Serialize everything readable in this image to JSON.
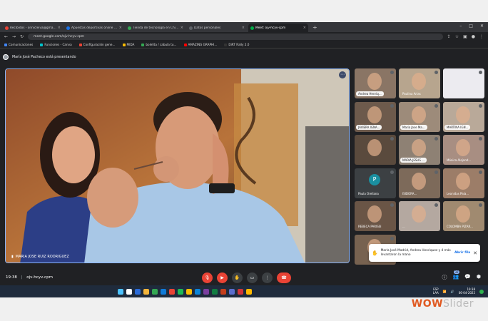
{
  "browser": {
    "tabs": [
      {
        "label": "Recibidos - onnicleiva@gmail.com",
        "color": "#ea4335"
      },
      {
        "label": "Apuestas deportivas online en Chile",
        "color": "#1a73e8"
      },
      {
        "label": "Tienda de tecnología en Chile |",
        "color": "#34a853"
      },
      {
        "label": "Datos personales",
        "color": "#5f6368"
      },
      {
        "label": "Meet: ojv-hcyv-cpm",
        "color": "#00ac47",
        "active": true
      }
    ],
    "new_tab": "+",
    "url": "meet.google.com/ojv-hcyv-cpm",
    "bookmarks": [
      {
        "label": "Comunicaciones",
        "color": "#4285f4"
      },
      {
        "label": "Funciones - Canva",
        "color": "#00c4cc"
      },
      {
        "label": "Configuración gene...",
        "color": "#ea4335"
      },
      {
        "label": "MIDA",
        "color": "#fbbc04"
      },
      {
        "label": "bolelita / cabula tu...",
        "color": "#34a853"
      },
      {
        "label": "AMAZING GRAPHI...",
        "color": "#ff0000"
      },
      {
        "label": "DiRT Rally 2.0",
        "color": "#333333"
      }
    ]
  },
  "meet": {
    "presenting_text": "María José Pacheco está presentando",
    "main_participant": "MARIA JOSE RUIZ RODRIGUEZ",
    "tiles": [
      {
        "name": "Andrea Henriq...",
        "bg": "#8a7565",
        "dark": false
      },
      {
        "name": "Paulina Arias",
        "bg": "#b7a58e",
        "dark": true
      },
      {
        "name": "",
        "bg": "#ecebf0",
        "dark": false
      },
      {
        "name": "JAVIERA IGNA...",
        "bg": "#6d5a4c",
        "dark": false
      },
      {
        "name": "María Jose Ma...",
        "bg": "#9d8b7a",
        "dark": false
      },
      {
        "name": "MARTINA IGN...",
        "bg": "#b9a999",
        "dark": false
      },
      {
        "name": "",
        "bg": "#5a4a3d",
        "dark": false
      },
      {
        "name": "MARIA JESUS ...",
        "bg": "#8e8174",
        "dark": false
      },
      {
        "name": "Mónica Alejand...",
        "bg": "#a88e82",
        "dark": true
      },
      {
        "name": "Paula Orellana",
        "bg": "#3c4043",
        "dark": true,
        "avatar": "P"
      },
      {
        "name": "ISIDORA...",
        "bg": "#7d6a5a",
        "dark": true
      },
      {
        "name": "Leonidas Pala...",
        "bg": "#9c7d68",
        "dark": true
      },
      {
        "name": "REBECA PARISSI",
        "bg": "#6a5546",
        "dark": true
      },
      {
        "name": "...",
        "bg": "#b4a8a0",
        "dark": true
      },
      {
        "name": "COLOMBA PIZAR...",
        "bg": "#a08a70",
        "dark": true
      },
      {
        "name": "",
        "bg": "#776250",
        "dark": true
      }
    ],
    "toast": {
      "text": "María José Madrid, Andrea Henriquez y 4 más levantaron la mano",
      "action": "Abrir fila"
    },
    "time": "19:38",
    "meeting_code": "ojv-hcyv-cpm",
    "participant_count": "32"
  },
  "taskbar": {
    "lang": [
      "ESP",
      "LAA"
    ],
    "time": "19:38",
    "date": "06-04-2022"
  },
  "watermark": {
    "part1": "WOW",
    "part2": "Slider"
  }
}
